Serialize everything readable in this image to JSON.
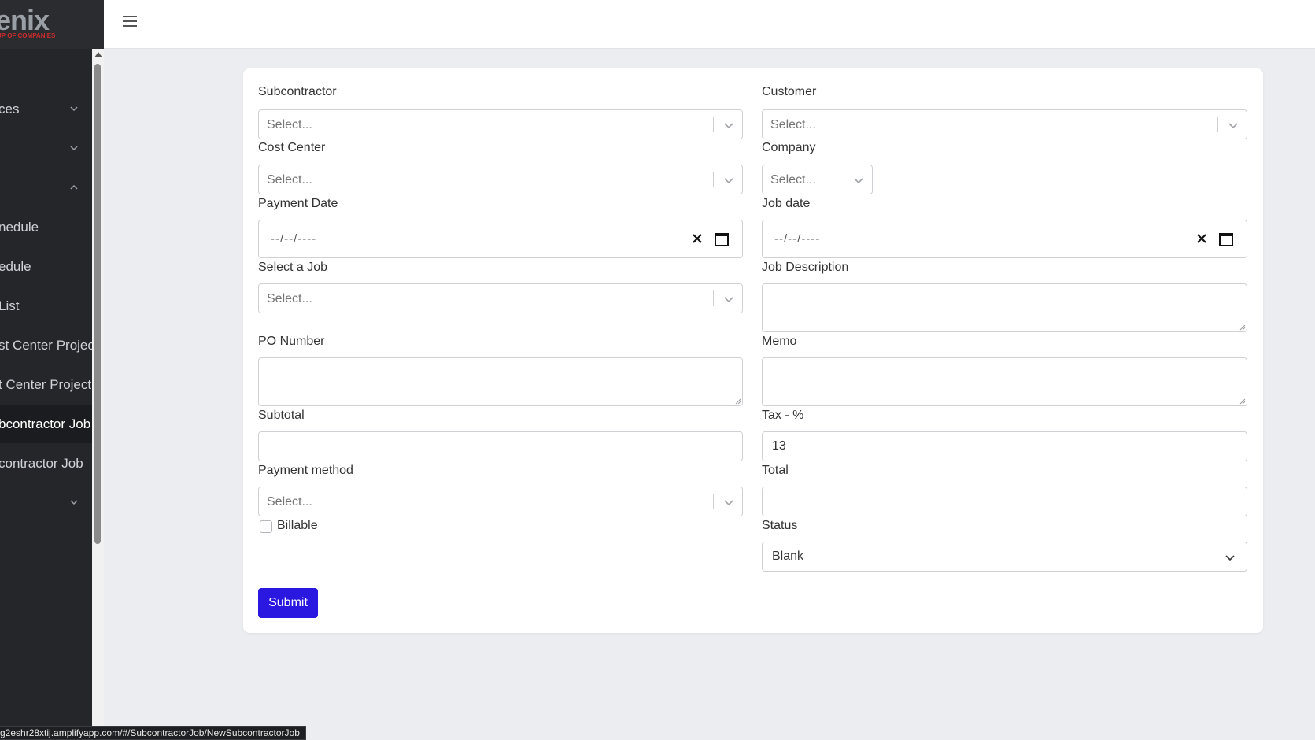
{
  "sidebar": {
    "logo_main": "enix",
    "logo_sub": "UP OF COMPANIES",
    "items": [
      {
        "label": "ces",
        "chevron": "down"
      },
      {
        "label": "",
        "chevron": "down"
      },
      {
        "label": "",
        "chevron": "up"
      },
      {
        "label": "nedule",
        "chevron": ""
      },
      {
        "label": "edule",
        "chevron": ""
      },
      {
        "label": "List",
        "chevron": ""
      },
      {
        "label": "st Center Project",
        "chevron": ""
      },
      {
        "label": "t Center Project",
        "chevron": ""
      },
      {
        "label": "bcontractor Job",
        "chevron": "",
        "active": true
      },
      {
        "label": "contractor Job",
        "chevron": ""
      },
      {
        "label": "",
        "chevron": "down"
      }
    ]
  },
  "form": {
    "subcontractor_label": "Subcontractor",
    "customer_label": "Customer",
    "cost_center_label": "Cost Center",
    "company_label": "Company",
    "payment_date_label": "Payment Date",
    "job_date_label": "Job date",
    "select_job_label": "Select a Job",
    "job_description_label": "Job Description",
    "po_number_label": "PO Number",
    "memo_label": "Memo",
    "subtotal_label": "Subtotal",
    "tax_label": "Tax - %",
    "tax_value": "13",
    "payment_method_label": "Payment method",
    "total_label": "Total",
    "billable_label": "Billable",
    "status_label": "Status",
    "status_value": "Blank",
    "select_placeholder": "Select...",
    "date_placeholder": "--/--/----",
    "submit_label": "Submit"
  },
  "statusbar": {
    "url": "g2eshr28xtij.amplifyapp.com/#/SubcontractorJob/NewSubcontractorJob"
  },
  "colors": {
    "sidebar_bg": "#24262a",
    "page_bg": "#ecedf0",
    "submit_bg": "#2a17e0",
    "logo_red": "#d02b2b"
  }
}
